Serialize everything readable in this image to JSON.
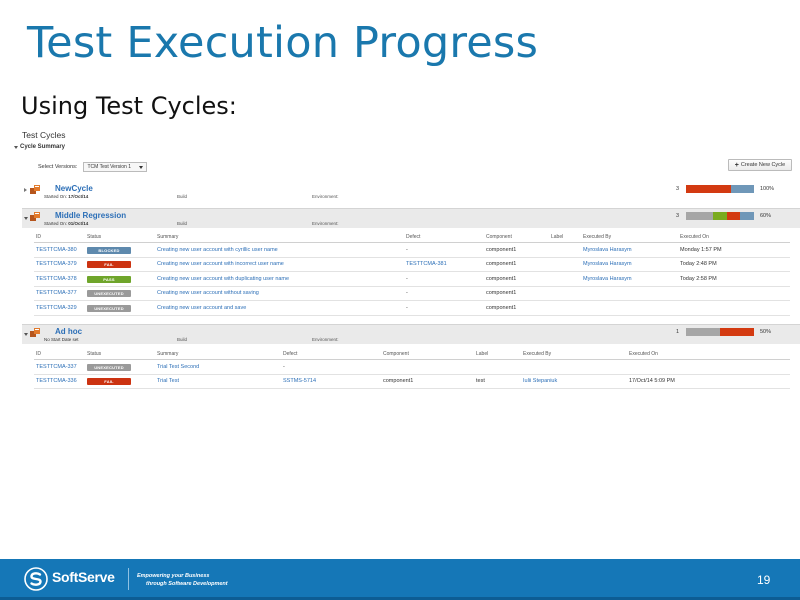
{
  "slide": {
    "title": "Test Execution Progress",
    "subtitle": "Using Test Cycles:"
  },
  "ui": {
    "heading": "Test Cycles",
    "section_label": "Cycle Summary",
    "select_versions_label": "Select Versions:",
    "selected_version": "TCM Test Version 1",
    "create_button_label": "Create New Cycle",
    "labels": {
      "started_on": "Started On:",
      "build": "Build",
      "environment": "Environment:"
    }
  },
  "cycles": [
    {
      "name": "NewCycle",
      "started": "17/Oct/14",
      "count": "3",
      "percent": "100%",
      "bar": [
        {
          "color": "#d33a11",
          "fraction": 0.66
        },
        {
          "color": "#6f97b8",
          "fraction": 0.34
        }
      ]
    },
    {
      "name": "Middle Regression",
      "started": "01/Oct/14",
      "count": "3",
      "percent": "60%",
      "bar": [
        {
          "color": "#a6a6a6",
          "fraction": 0.4
        },
        {
          "color": "#7aab1f",
          "fraction": 0.2
        },
        {
          "color": "#d33a11",
          "fraction": 0.2
        },
        {
          "color": "#6f97b8",
          "fraction": 0.2
        }
      ],
      "columns": [
        "ID",
        "Status",
        "Summary",
        "Defect",
        "Component",
        "Label",
        "Executed By",
        "Executed On"
      ],
      "rows": [
        {
          "id": "TESTTCMA-380",
          "status": "BLOCKED",
          "status_color": "#5e89ad",
          "summary": "Creating new user account with cyrillic user name",
          "defect": "-",
          "component": "component1",
          "label": "",
          "executed_by": "Myroslava Harasym",
          "executed_on": "Monday 1:57 PM"
        },
        {
          "id": "TESTTCMA-379",
          "status": "FAIL",
          "status_color": "#cc3311",
          "summary": "Creating new user account with incorrect user name",
          "defect": "TESTTCMA-381",
          "component": "component1",
          "label": "",
          "executed_by": "Myroslava Harasym",
          "executed_on": "Today 2:48 PM"
        },
        {
          "id": "TESTTCMA-378",
          "status": "PASS",
          "status_color": "#6fa52b",
          "summary": "Creating new user account with duplicating user name",
          "defect": "-",
          "component": "component1",
          "label": "",
          "executed_by": "Myroslava Harasym",
          "executed_on": "Today 2:58 PM"
        },
        {
          "id": "TESTTCMA-377",
          "status": "UNEXECUTED",
          "status_color": "#9a9a9a",
          "summary": "Creating new user account without saving",
          "defect": "-",
          "component": "component1",
          "label": "",
          "executed_by": "",
          "executed_on": ""
        },
        {
          "id": "TESTTCMA-329",
          "status": "UNEXECUTED",
          "status_color": "#9a9a9a",
          "summary": "Creating new user account and save",
          "defect": "-",
          "component": "component1",
          "label": "",
          "executed_by": "",
          "executed_on": ""
        }
      ]
    },
    {
      "name": "Ad hoc",
      "started_text": "No Start Date set",
      "count": "1",
      "percent": "50%",
      "bar": [
        {
          "color": "#a6a6a6",
          "fraction": 0.5
        },
        {
          "color": "#d33a11",
          "fraction": 0.5
        }
      ],
      "columns": [
        "ID",
        "Status",
        "Summary",
        "Defect",
        "Component",
        "Label",
        "Executed By",
        "Executed On"
      ],
      "rows": [
        {
          "id": "TESTTCMA-337",
          "status": "UNEXECUTED",
          "status_color": "#9a9a9a",
          "summary": "Trial Test Second",
          "defect": "-",
          "component": "",
          "label": "",
          "executed_by": "",
          "executed_on": ""
        },
        {
          "id": "TESTTCMA-336",
          "status": "FAIL",
          "status_color": "#cc3311",
          "summary": "Trial Test",
          "defect": "SSTMS-5714",
          "component": "component1",
          "label": "test",
          "executed_by": "Iulii Stepaniuk",
          "executed_on": "17/Oct/14 5:09 PM"
        }
      ]
    }
  ],
  "footer": {
    "brand": "SoftServe",
    "tagline_1": "Empowering your Business",
    "tagline_2": "through Software Development",
    "page_number": "19"
  },
  "colors": {
    "title": "#1a78ad",
    "footer": "#1577b7",
    "link": "#2c6fb7"
  }
}
